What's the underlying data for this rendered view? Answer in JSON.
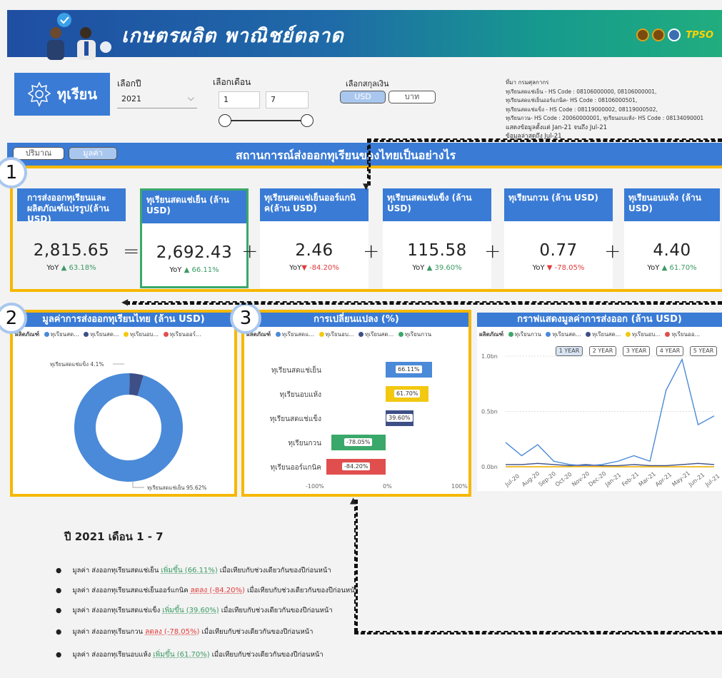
{
  "banner": {
    "title": "เกษตรผลิต พาณิชย์ตลาด",
    "brand": "TPSO"
  },
  "product": {
    "name": "ทุเรียน"
  },
  "filters": {
    "year_label": "เลือกปี",
    "year_value": "2021",
    "month_label": "เลือกเดือน",
    "month_from": "1",
    "month_to": "7",
    "currency_label": "เลือกสกุลเงิน",
    "currency_usd": "USD",
    "currency_thb": "บาท",
    "view_qty": "ปริมาณ",
    "view_value": "มูลค่า"
  },
  "source_note": [
    "ที่มา กรมศุลกากร",
    "ทุเรียนสดแช่เย็น - HS Code : 08106000000, 08106000001,",
    "ทุเรียนสดแช่เย็นออร์แกนิค- HS Code : 08106000501,",
    "ทุเรียนสดแช่แข็ง - HS Code : 08119000002, 08119000502,",
    "ทุเรียนกวน- HS Code : 20060000001, ทุเรียนอบแห้ง- HS Code : 08134090001",
    "แสดงข้อมูลตั้งแต่ Jan-21 จนถึง Jul-21",
    "ข้อมูลล่าสุดถึง Jul-21"
  ],
  "header": {
    "title": "สถานการณ์ส่งออกทุเรียนของไทยเป็นอย่างไร"
  },
  "markers": [
    "1",
    "2",
    "3"
  ],
  "kpis": [
    {
      "title": "การส่งออกทุเรียนและผลิตภัณฑ์แปรรูป(ล้าน USD)",
      "value": "2,815.65",
      "yoy_label": "YoY",
      "yoy": "63.18%",
      "dir": "up"
    },
    {
      "title": "ทุเรียนสดแช่เย็น (ล้าน USD)",
      "value": "2,692.43",
      "yoy_label": "YoY",
      "yoy": "66.11%",
      "dir": "up"
    },
    {
      "title": "ทุเรียนสดแช่เย็นออร์แกนิค(ล้าน USD)",
      "value": "2.46",
      "yoy_label": "YoY",
      "yoy": "-84.20%",
      "dir": "down"
    },
    {
      "title": "ทุเรียนสดแช่แข็ง (ล้าน USD)",
      "value": "115.58",
      "yoy_label": "YoY",
      "yoy": "39.60%",
      "dir": "up"
    },
    {
      "title": "ทุเรียนกวน (ล้าน USD)",
      "value": "0.77",
      "yoy_label": "YoY",
      "yoy": "-78.05%",
      "dir": "down"
    },
    {
      "title": "ทุเรียนอบแห้ง (ล้าน USD)",
      "value": "4.40",
      "yoy_label": "YoY",
      "yoy": "61.70%",
      "dir": "up"
    }
  ],
  "operators": [
    "=",
    "+",
    "+",
    "+",
    "+"
  ],
  "legend_label": "ผลิตภัณฑ์",
  "panel_donut": {
    "title": "มูลค่าการส่งออกทุเรียนไทย (ล้าน USD)",
    "legend": [
      "ทุเรียนสด...",
      "ทุเรียนสด...",
      "ทุเรียนอบ...",
      "ทุเรียนออร์..."
    ]
  },
  "panel_bar": {
    "title": "การเปลี่ยนแปลง (%)",
    "legend": [
      "ทุเรียนสดแ...",
      "ทุเรียนอบ...",
      "ทุเรียนสด...",
      "ทุเรียนกวน"
    ]
  },
  "panel_line": {
    "title": "กราฟแสดงมูลค่าการส่งออก (ล้าน USD)",
    "legend": [
      "ทุเรียนกวน",
      "ทุเรียนสด...",
      "ทุเรียนสด...",
      "ทุเรียนอบ...",
      "ทุเรียนออ..."
    ],
    "range_buttons": [
      "1 YEAR",
      "2 YEAR",
      "3 YEAR",
      "4 YEAR",
      "5 YEAR"
    ]
  },
  "colors": {
    "accent": "#3a7bd5",
    "frame": "#f6b800",
    "up": "#3a9a63",
    "down": "#e23a3a"
  },
  "chart_data": [
    {
      "type": "pie",
      "labels": [
        "ทุเรียนสดแช่เย็น",
        "ทุเรียนสดแช่แข็ง"
      ],
      "values": [
        95.62,
        4.1
      ],
      "label_texts": [
        "ทุเรียนสดแช่เย็น 95.62%",
        "ทุเรียนสดแช่แข็ง 4.1%"
      ],
      "colors": [
        "#4a8ad8",
        "#3d4f86"
      ]
    },
    {
      "type": "bar",
      "categories": [
        "ทุเรียนสดแช่เย็น",
        "ทุเรียนอบแห้ง",
        "ทุเรียนสดแช่แข็ง",
        "ทุเรียนกวน",
        "ทุเรียนออร์แกนิค"
      ],
      "values": [
        66.11,
        61.7,
        39.6,
        -78.05,
        -84.2
      ],
      "value_labels": [
        "66.11%",
        "61.70%",
        "39.60%",
        "-78.05%",
        "-84.20%"
      ],
      "colors": [
        "#4a8ad8",
        "#f2c811",
        "#3d4f86",
        "#3aa86a",
        "#e04e4e"
      ],
      "xticks": [
        "-100%",
        "0%",
        "100%"
      ],
      "xlim": [
        -100,
        100
      ]
    },
    {
      "type": "line",
      "x": [
        "Jul-20",
        "Aug-20",
        "Sep-20",
        "Oct-20",
        "Nov-20",
        "Dec-20",
        "Jan-21",
        "Feb-21",
        "Mar-21",
        "Apr-21",
        "May-21",
        "Jun-21",
        "Jul-21"
      ],
      "yticks": [
        "0.0bn",
        "0.5bn",
        "1.0bn"
      ],
      "ylim": [
        0,
        1.0
      ],
      "series": [
        {
          "color": "#4a8ad8",
          "values": [
            0.22,
            0.1,
            0.2,
            0.05,
            0.02,
            0.01,
            0.02,
            0.05,
            0.1,
            0.05,
            0.69,
            0.97,
            0.38,
            0.46
          ]
        },
        {
          "color": "#3d4f86",
          "values": [
            0.02,
            0.02,
            0.03,
            0.02,
            0.01,
            0.02,
            0.01,
            0.01,
            0.02,
            0.01,
            0.01,
            0.02,
            0.03,
            0.02
          ]
        },
        {
          "color": "#f2c811",
          "values": [
            0.0,
            0.0,
            0.0,
            0.0,
            0.0,
            0.0,
            0.0,
            0.0,
            0.0,
            0.0,
            0.0,
            0.0,
            0.0,
            0.0
          ]
        },
        {
          "color": "#e04e4e",
          "values": [
            0.0,
            0.0,
            0.0,
            0.0,
            0.0,
            0.01,
            0.0,
            0.0,
            0.0,
            0.0,
            0.0,
            0.0,
            0.0,
            0.0
          ]
        }
      ]
    }
  ],
  "summary": {
    "title": "ปี 2021 เดือน 1 - 7",
    "lines": [
      {
        "pre": "มูลค่า ส่งออกทุเรียนสดแช่เย็น ",
        "change": "เพิ่มขึ้น (66.11%)",
        "dir": "up",
        "post": " เมื่อเทียบกับช่วงเดียวกันของปีก่อนหน้า"
      },
      {
        "pre": "มูลค่า ส่งออกทุเรียนสดแช่เย็นออร์แกนิค ",
        "change": "ลดลง (-84.20%)",
        "dir": "down",
        "post": " เมื่อเทียบกับช่วงเดียวกันของปีก่อนหน้า"
      },
      {
        "pre": "มูลค่า ส่งออกทุเรียนสดแช่แข็ง ",
        "change": "เพิ่มขึ้น (39.60%)",
        "dir": "up",
        "post": " เมื่อเทียบกับช่วงเดียวกันของปีก่อนหน้า"
      },
      {
        "pre": "มูลค่า ส่งออกทุเรียนกวน ",
        "change": "ลดลง (-78.05%)",
        "dir": "down",
        "post": " เมื่อเทียบกับช่วงเดียวกันของปีก่อนหน้า"
      },
      {
        "pre": "มูลค่า ส่งออกทุเรียนอบแห้ง ",
        "change": "เพิ่มขึ้น (61.70%)",
        "dir": "up",
        "post": " เมื่อเทียบกับช่วงเดียวกันของปีก่อนหน้า"
      }
    ]
  }
}
